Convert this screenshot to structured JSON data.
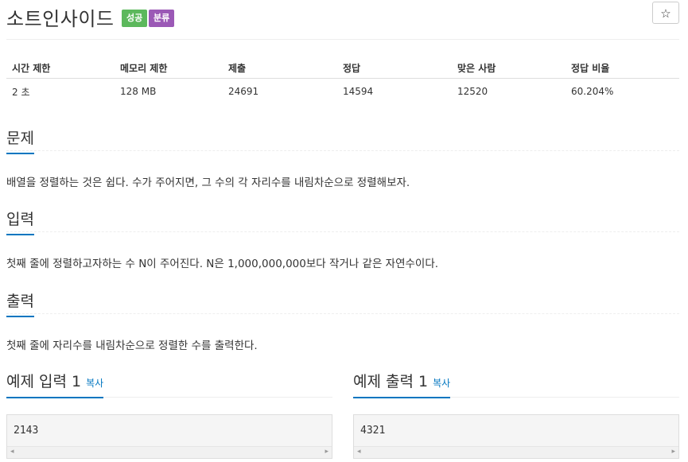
{
  "problem": {
    "title": "소트인사이드",
    "badges": {
      "success": "성공",
      "tag": "분류"
    },
    "star": "☆"
  },
  "info_table": {
    "headers": [
      "시간 제한",
      "메모리 제한",
      "제출",
      "정답",
      "맞은 사람",
      "정답 비율"
    ],
    "values": [
      "2 초",
      "128 MB",
      "24691",
      "14594",
      "12520",
      "60.204%"
    ]
  },
  "sections": {
    "problem": {
      "heading": "문제",
      "text": "배열을 정렬하는 것은 쉽다. 수가 주어지면, 그 수의 각 자리수를 내림차순으로 정렬해보자."
    },
    "input": {
      "heading": "입력",
      "text": "첫째 줄에 정렬하고자하는 수 N이 주어진다. N은 1,000,000,000보다 작거나 같은 자연수이다."
    },
    "output": {
      "heading": "출력",
      "text": "첫째 줄에 자리수를 내림차순으로 정렬한 수를 출력한다."
    }
  },
  "examples": {
    "input": {
      "heading": "예제 입력 1",
      "copy": "복사",
      "content": "2143"
    },
    "output": {
      "heading": "예제 출력 1",
      "copy": "복사",
      "content": "4321"
    }
  },
  "icons": {
    "scroll_left": "◂",
    "scroll_right": "▸"
  },
  "colors": {
    "success": "#5cb85c",
    "tag": "#9b59b6",
    "accent": "#0076c0"
  }
}
